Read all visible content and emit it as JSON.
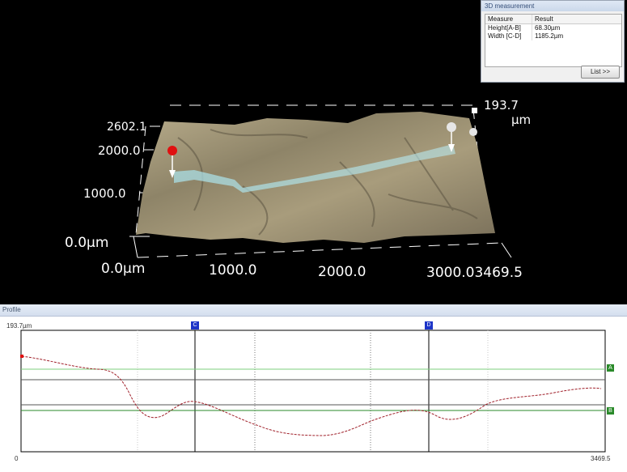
{
  "viewer": {
    "z_max": "193.7",
    "z_unit": "µm",
    "y_ticks": [
      "2602.1",
      "2000.0",
      "1000.0",
      "0.0µm"
    ],
    "x_ticks": [
      "0.0µm",
      "1000.0",
      "2000.0",
      "3000.03469.5"
    ]
  },
  "measurement": {
    "title": "3D measurement",
    "col_measure": "Measure",
    "col_result": "Result",
    "rows": [
      {
        "measure": "Height[A-B]",
        "result": "68.30µm"
      },
      {
        "measure": "Width [C-D]",
        "result": "1185.2µm"
      }
    ],
    "list_button": "List >>"
  },
  "profile": {
    "title": "Profile",
    "y_max_label": "193.7µm",
    "x_start": "0",
    "x_end": "3469.5",
    "marker_c": "C",
    "marker_d": "D",
    "marker_a": "A",
    "marker_b": "B"
  },
  "colors": {
    "profile_line": "#a0202a",
    "marker_blue": "#1c34c8",
    "marker_green": "#2a8a2a",
    "start_point": "#e01010"
  }
}
